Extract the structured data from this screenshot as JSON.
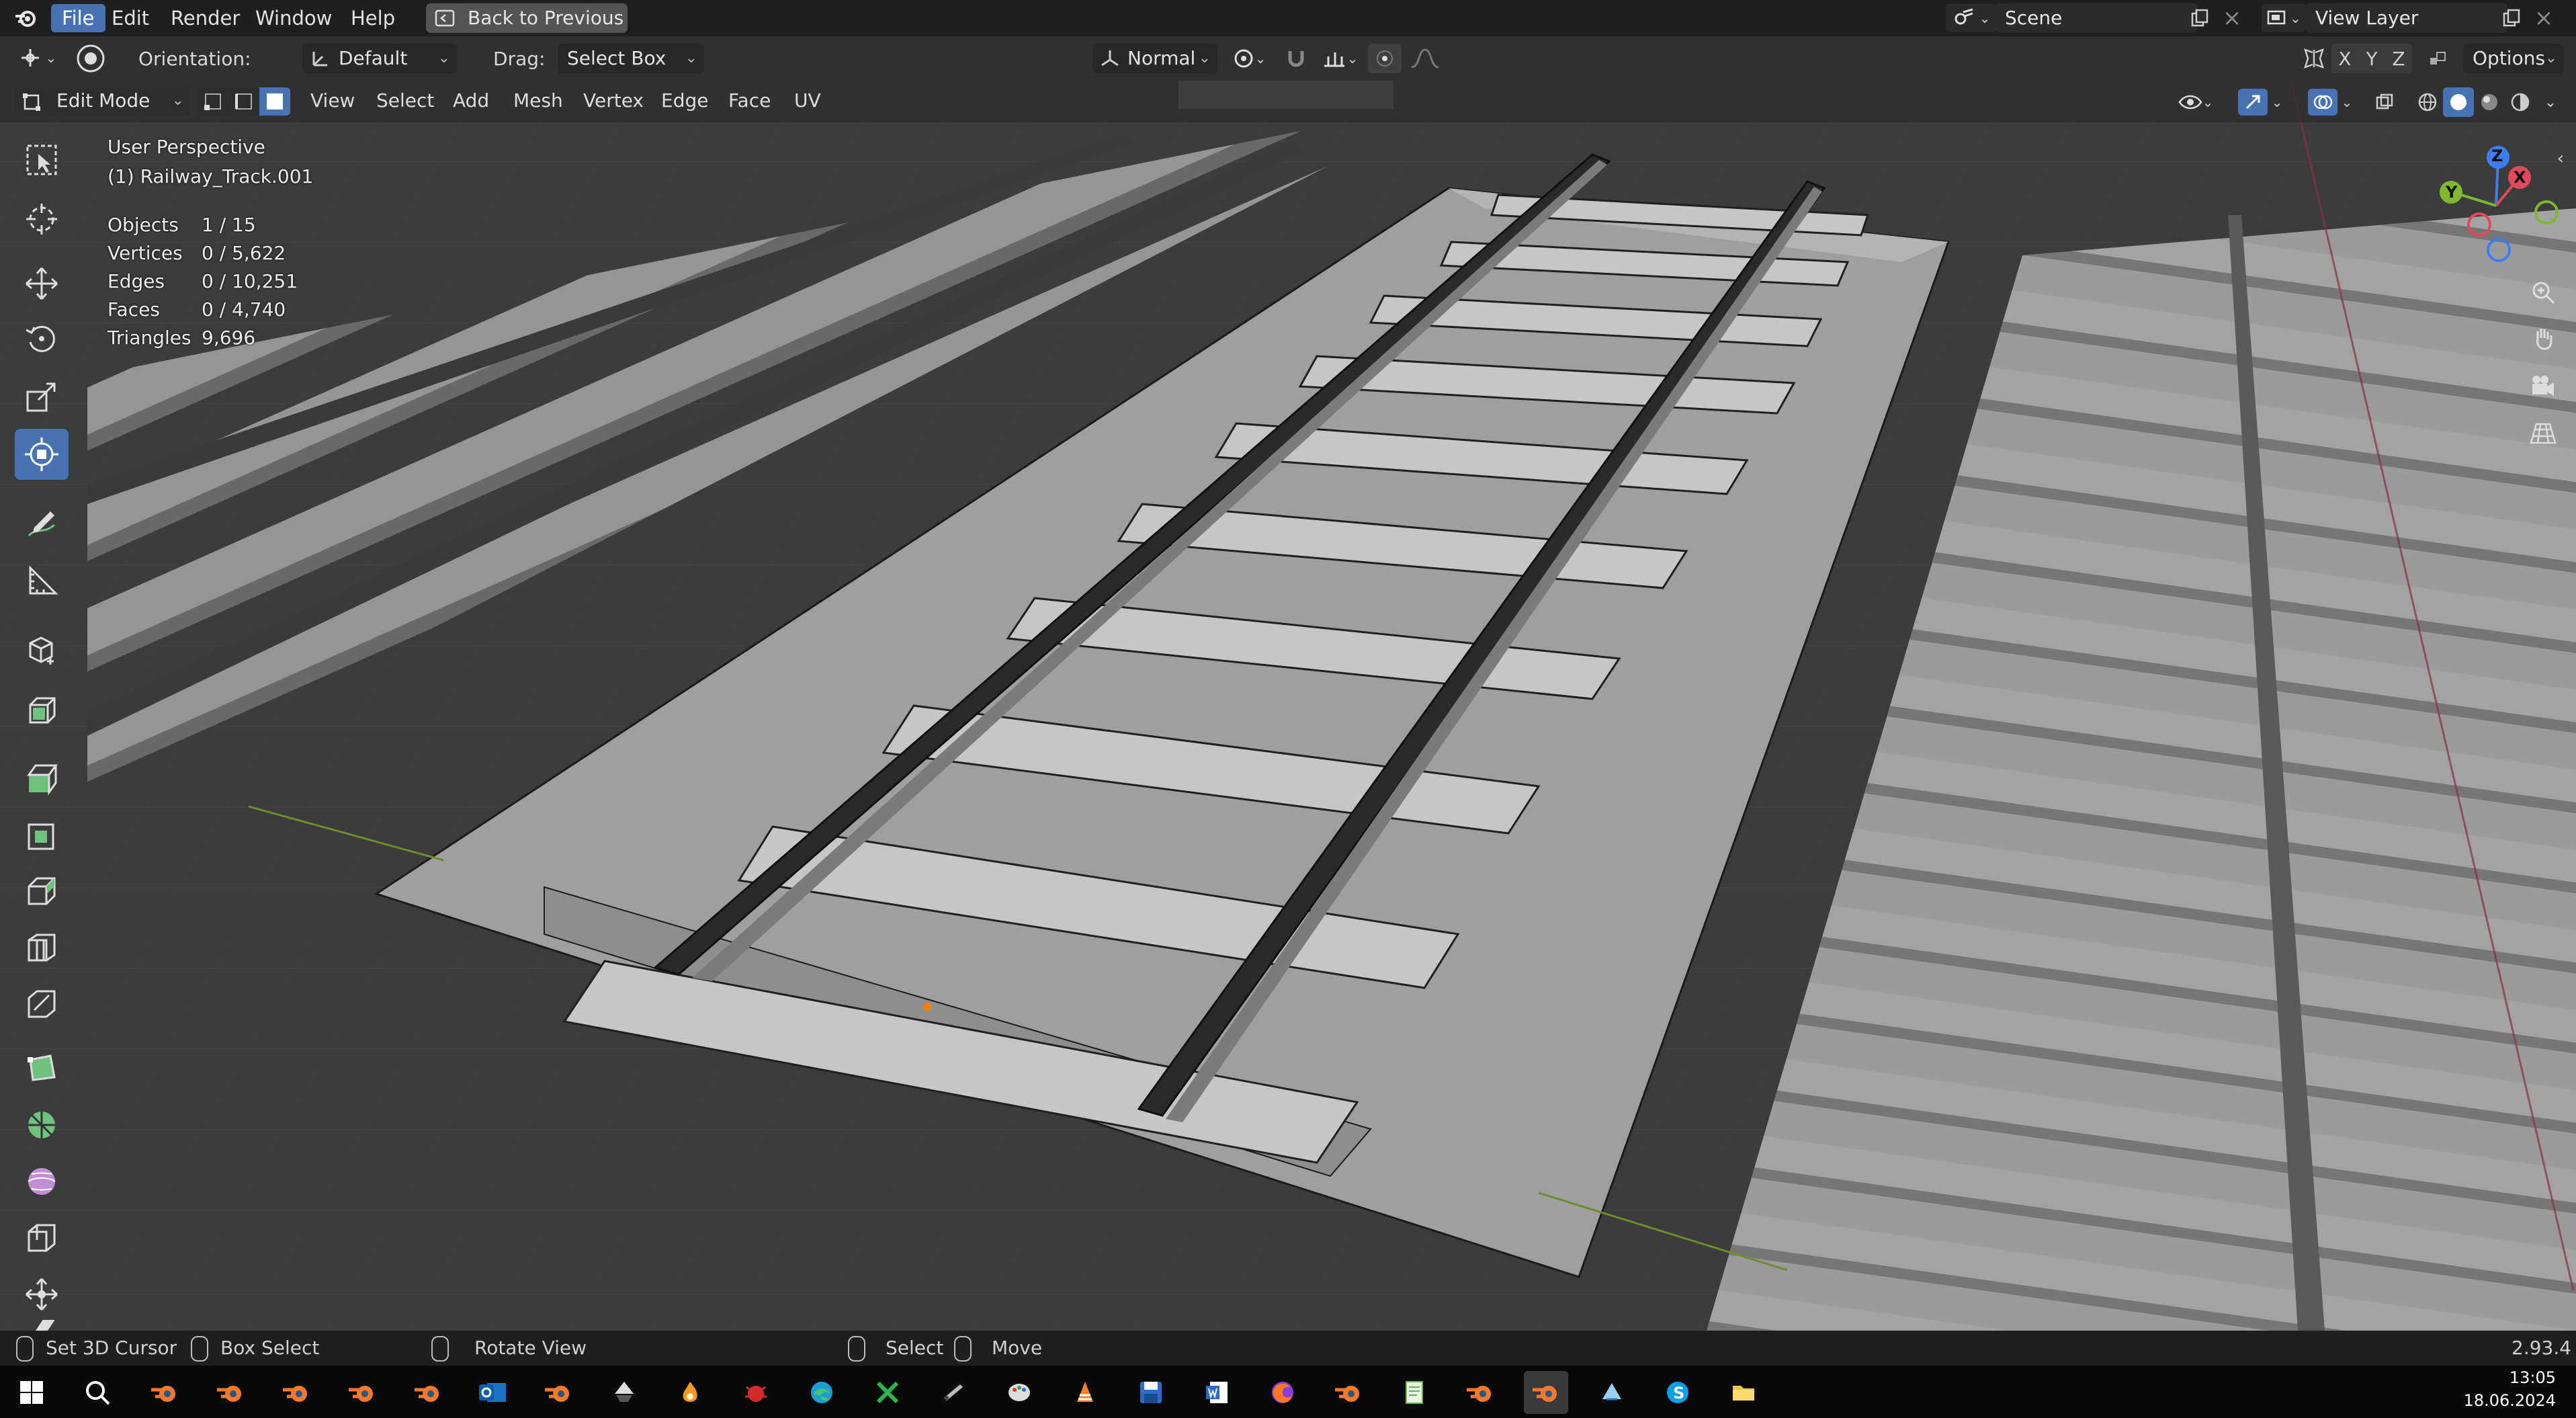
{
  "topbar": {
    "menu": [
      {
        "label": "File",
        "active": true
      },
      {
        "label": "Edit"
      },
      {
        "label": "Render"
      },
      {
        "label": "Window"
      },
      {
        "label": "Help"
      }
    ],
    "back_label": "Back to Previous",
    "scene_label": "Scene",
    "view_layer_label": "View Layer"
  },
  "header": {
    "orientation_label": "Orientation:",
    "orientation_value": "Default",
    "drag_label": "Drag:",
    "drag_value": "Select Box",
    "pivot_value": "Normal",
    "axes": [
      "X",
      "Y",
      "Z"
    ],
    "options_label": "Options"
  },
  "mode_header": {
    "mode_value": "Edit Mode",
    "menus": [
      "View",
      "Select",
      "Add",
      "Mesh",
      "Vertex",
      "Edge",
      "Face",
      "UV"
    ]
  },
  "viewport": {
    "perspective": "User Perspective",
    "object_name": "(1) Railway_Track.001",
    "stats": [
      {
        "label": "Objects",
        "value": "1 / 15"
      },
      {
        "label": "Vertices",
        "value": "0 / 5,622"
      },
      {
        "label": "Edges",
        "value": "0 / 10,251"
      },
      {
        "label": "Faces",
        "value": "0 / 4,740"
      },
      {
        "label": "Triangles",
        "value": "9,696"
      }
    ],
    "gizmo_axes": {
      "x": "X",
      "y": "Y",
      "z": "Z"
    }
  },
  "statusbar": {
    "items": [
      {
        "label": "Set 3D Cursor"
      },
      {
        "label": "Box Select"
      },
      {
        "label": "Rotate View"
      },
      {
        "label": "Select"
      },
      {
        "label": "Move"
      }
    ],
    "version": "2.93.4"
  },
  "taskbar": {
    "time": "13:05",
    "date": "18.06.2024"
  },
  "colors": {
    "accent": "#4772b3",
    "gizmo_x": "#e04a5a",
    "gizmo_y": "#7fb82e",
    "gizmo_z": "#3c7ff0"
  }
}
